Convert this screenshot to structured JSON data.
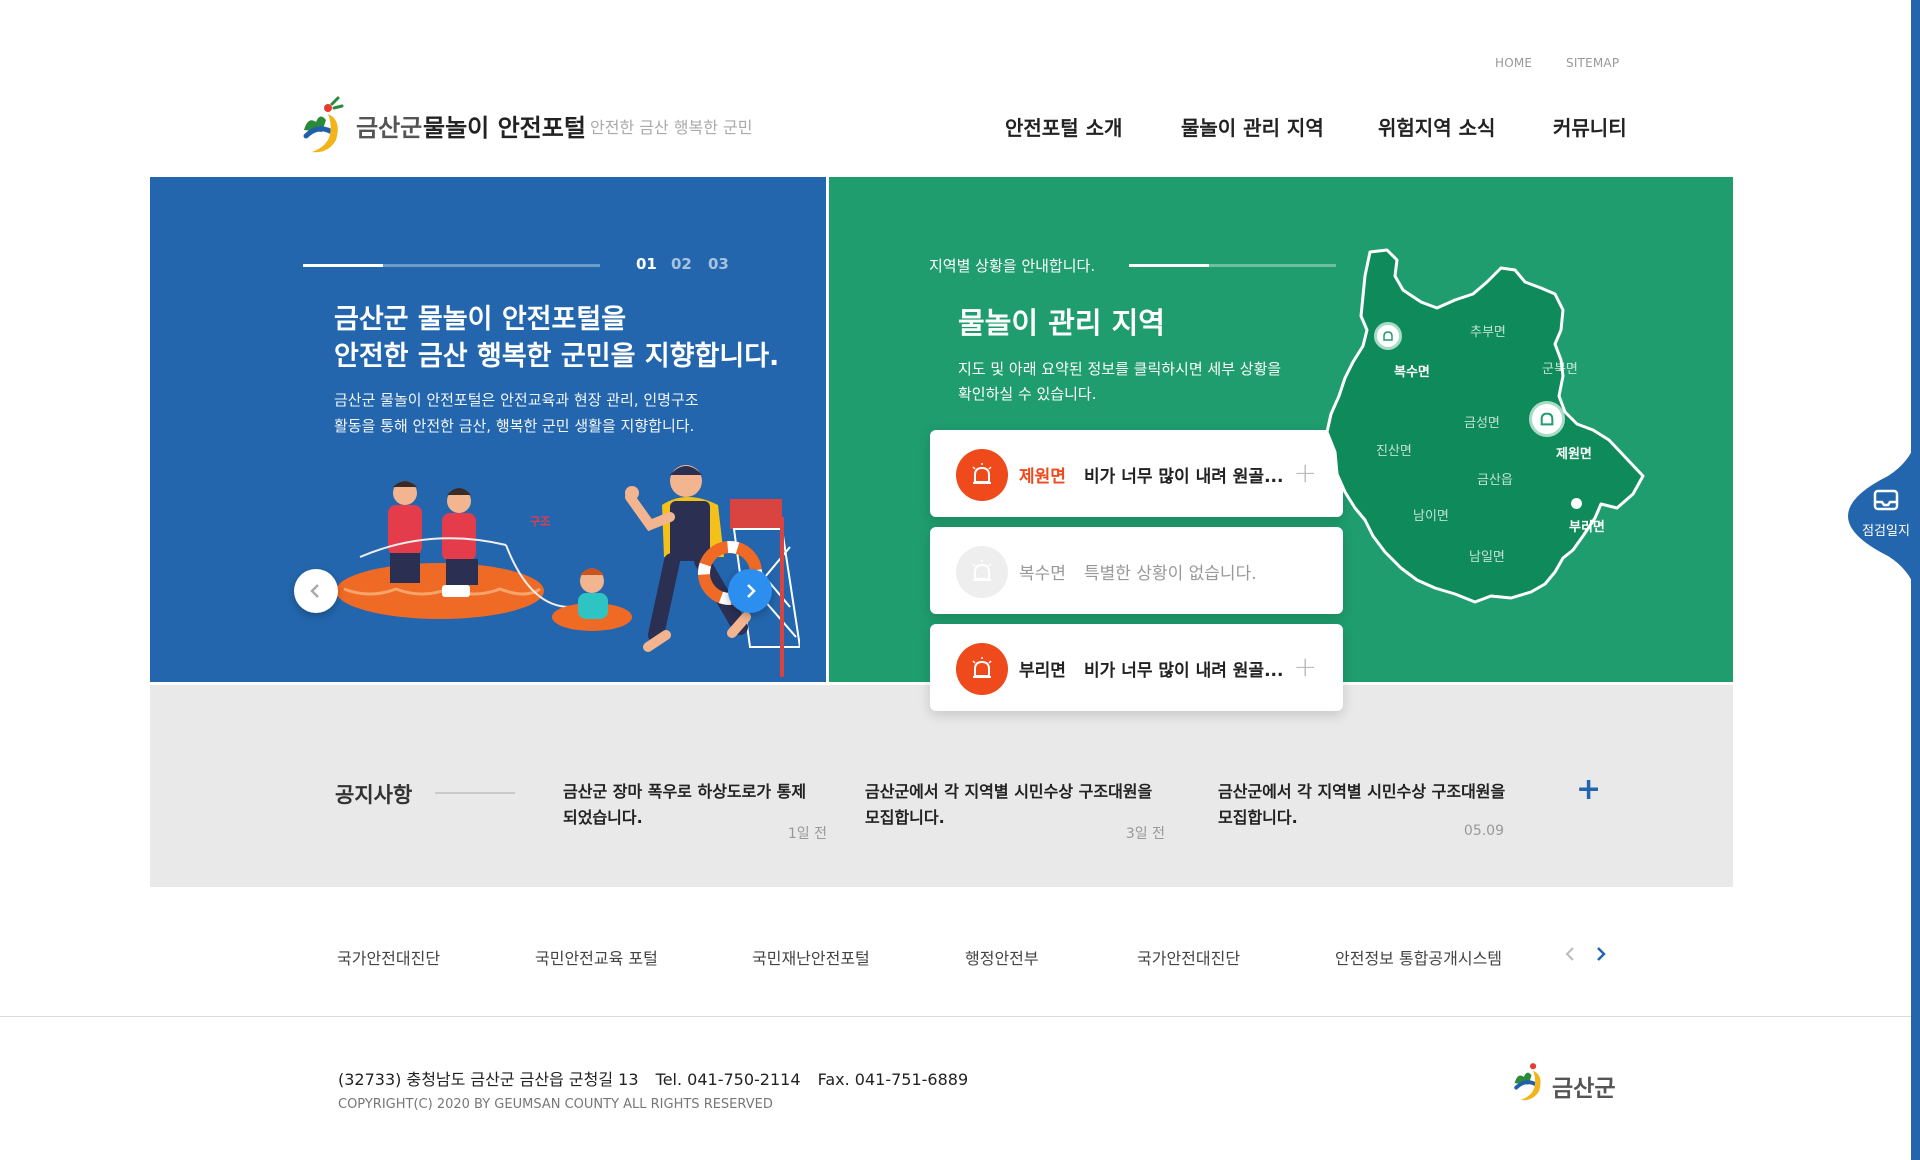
{
  "header": {
    "util_links": [
      "HOME",
      "SITEMAP"
    ],
    "brand_county": "금산군",
    "brand_portal": "물놀이 안전포털",
    "slogan": "안전한 금산 행복한 군민",
    "gnb": [
      "안전포털 소개",
      "물놀이 관리 지역",
      "위험지역 소식",
      "커뮤니티"
    ]
  },
  "hero": {
    "pages": [
      "01",
      "02",
      "03"
    ],
    "active_page": "01",
    "title_line1": "금산군 물놀이 안전포털을",
    "title_line2": "안전한 금산 행복한 군민을 지향합니다.",
    "desc_line1": "금산군 물놀이 안전포털은 안전교육과 현장 관리, 인명구조",
    "desc_line2": "활동을 통해 안전한 금산, 행복한 군민 생활을 지향합니다.",
    "rescue_text": "구조"
  },
  "regions": {
    "intro": "지역별 상황을 안내합니다.",
    "title": "물놀이 관리 지역",
    "desc_line1": "지도 및 아래 요약된 정보를 클릭하시면 세부 상황을",
    "desc_line2": "확인하실 수 있습니다.",
    "cards": [
      {
        "region": "제원면",
        "message": "비가 너무 많이 내려 원골...",
        "status": "alert",
        "region_color": "#ee4a1b"
      },
      {
        "region": "복수면",
        "message": "특별한 상황이 없습니다.",
        "status": "none",
        "region_color": "#999999"
      },
      {
        "region": "부리면",
        "message": "비가 너무 많이 내려 원골...",
        "status": "alert",
        "region_color": "#222222"
      }
    ],
    "map_labels": [
      "추부면",
      "군북면",
      "복수면",
      "금성면",
      "진산면",
      "제원면",
      "금산읍",
      "남이면",
      "부리면",
      "남일면"
    ],
    "map_highlight": [
      "복수면",
      "제원면",
      "부리면"
    ]
  },
  "notice": {
    "title": "공지사항",
    "items": [
      {
        "title_line1": "금산군 장마 폭우로 하상도로가 통제",
        "title_line2": "되었습니다.",
        "date": "1일 전"
      },
      {
        "title_line1": "금산군에서 각 지역별 시민수상 구조대원을",
        "title_line2": "모집합니다.",
        "date": "3일 전"
      },
      {
        "title_line1": "금산군에서 각 지역별 시민수상 구조대원을",
        "title_line2": "모집합니다.",
        "date": "05.09"
      }
    ],
    "more": "+"
  },
  "links": [
    "국가안전대진단",
    "국민안전교육 포털",
    "국민재난안전포털",
    "행정안전부",
    "국가안전대진단",
    "안전정보 통합공개시스템"
  ],
  "footer": {
    "address": "(32733) 충청남도 금산군 금산읍 군청길 13",
    "tel": "Tel. 041-750-2114",
    "fax": "Fax. 041-751-6889",
    "copyright": "COPYRIGHT(C) 2020 BY GEUMSAN COUNTY ALL RIGHTS RESERVED",
    "logo_text": "금산군"
  },
  "quick": {
    "label": "점검일지"
  },
  "colors": {
    "blue": "#2366ad",
    "green": "#1f9d6e",
    "alert": "#ee4a1b",
    "gray_band": "#e9e9e9"
  }
}
